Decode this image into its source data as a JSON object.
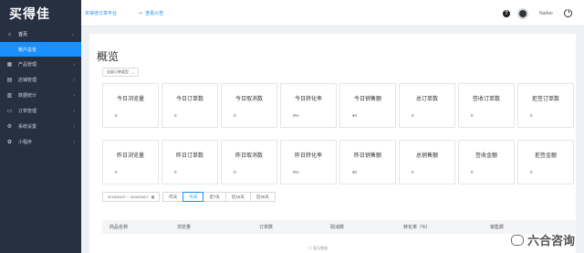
{
  "sidebar": {
    "logo": "买得佳",
    "items": [
      {
        "label": "首页",
        "icon": "home-icon",
        "glyph": "⌂",
        "open": true
      },
      {
        "label": "产品管理",
        "icon": "grid-icon",
        "glyph": "▦"
      },
      {
        "label": "店铺管理",
        "icon": "store-icon",
        "glyph": "▤"
      },
      {
        "label": "数据统计",
        "icon": "chart-icon",
        "glyph": "▥"
      },
      {
        "label": "订单管理",
        "icon": "order-icon",
        "glyph": "▭"
      },
      {
        "label": "系统设置",
        "icon": "settings-icon",
        "glyph": "⚙"
      },
      {
        "label": "小程序",
        "icon": "miniprogram-icon",
        "glyph": "✿"
      }
    ],
    "sub_item": "账户总览"
  },
  "topbar": {
    "crumb1": "买得佳订单平台",
    "crumb2": "查看公告",
    "username": "Nather"
  },
  "page": {
    "title": "概览",
    "select": "全部订单类型",
    "today_cards": [
      {
        "label": "今日浏览量",
        "value": "0"
      },
      {
        "label": "今日订单数",
        "value": "0"
      },
      {
        "label": "今日取消数",
        "value": "0"
      },
      {
        "label": "今日转化率",
        "value": "0%"
      },
      {
        "label": "今日销售额",
        "value": "¥0"
      },
      {
        "label": "总订单数",
        "value": "0"
      },
      {
        "label": "签收订单数",
        "value": "0"
      },
      {
        "label": "拒签订单数",
        "value": "0"
      }
    ],
    "yesterday_cards": [
      {
        "label": "昨日浏览量",
        "value": "0"
      },
      {
        "label": "昨日订单数",
        "value": "0"
      },
      {
        "label": "昨日取消数",
        "value": "0"
      },
      {
        "label": "昨日转化率",
        "value": "0%"
      },
      {
        "label": "昨日销售额",
        "value": "¥0"
      },
      {
        "label": "总销售额",
        "value": "0"
      },
      {
        "label": "签收金额",
        "value": "0"
      },
      {
        "label": "拒签金额",
        "value": "0"
      }
    ],
    "date_range": "2018/03/07 ~ 2018/03/07",
    "range_buttons": [
      "昨天",
      "今天",
      "近7天",
      "近15天",
      "近30天"
    ],
    "active_range": "今天",
    "table_headers": [
      "商品名称",
      "浏览量",
      "订单数",
      "取消数",
      "转化率（%）",
      "销售额"
    ],
    "empty_text": "暂无数据"
  },
  "watermark": "六合咨询",
  "colors": {
    "sidebar": "#263041",
    "accent": "#1890ff",
    "background": "#eef1f5"
  }
}
